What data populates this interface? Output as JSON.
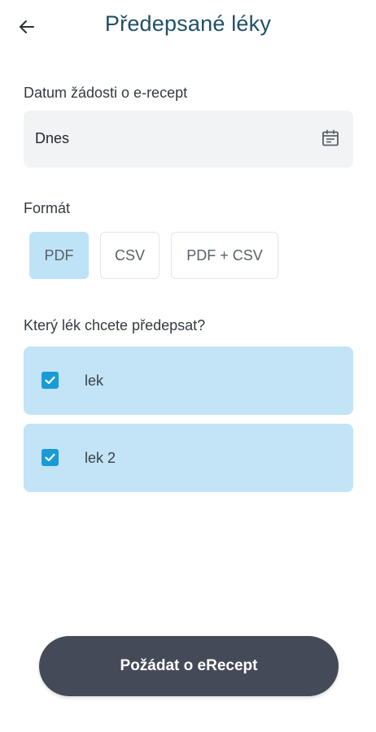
{
  "header": {
    "title": "Předepsané léky",
    "back_icon": "arrow-left-icon"
  },
  "date_section": {
    "label": "Datum žádosti o e-recept",
    "value": "Dnes",
    "icon": "calendar-icon"
  },
  "format_section": {
    "label": "Formát",
    "options": [
      {
        "label": "PDF",
        "selected": true
      },
      {
        "label": "CSV",
        "selected": false
      },
      {
        "label": "PDF + CSV",
        "selected": false
      }
    ]
  },
  "medication_section": {
    "label": "Který lék chcete předepsat?",
    "items": [
      {
        "label": "lek",
        "checked": true
      },
      {
        "label": "lek 2",
        "checked": true
      }
    ]
  },
  "submit": {
    "label": "Požádat o eRecept"
  },
  "colors": {
    "title": "#1f4f68",
    "selected_bg": "#bfe3f6",
    "checkbox": "#1a9bd6",
    "button_bg": "#454a58",
    "field_bg": "#f2f3f5"
  }
}
